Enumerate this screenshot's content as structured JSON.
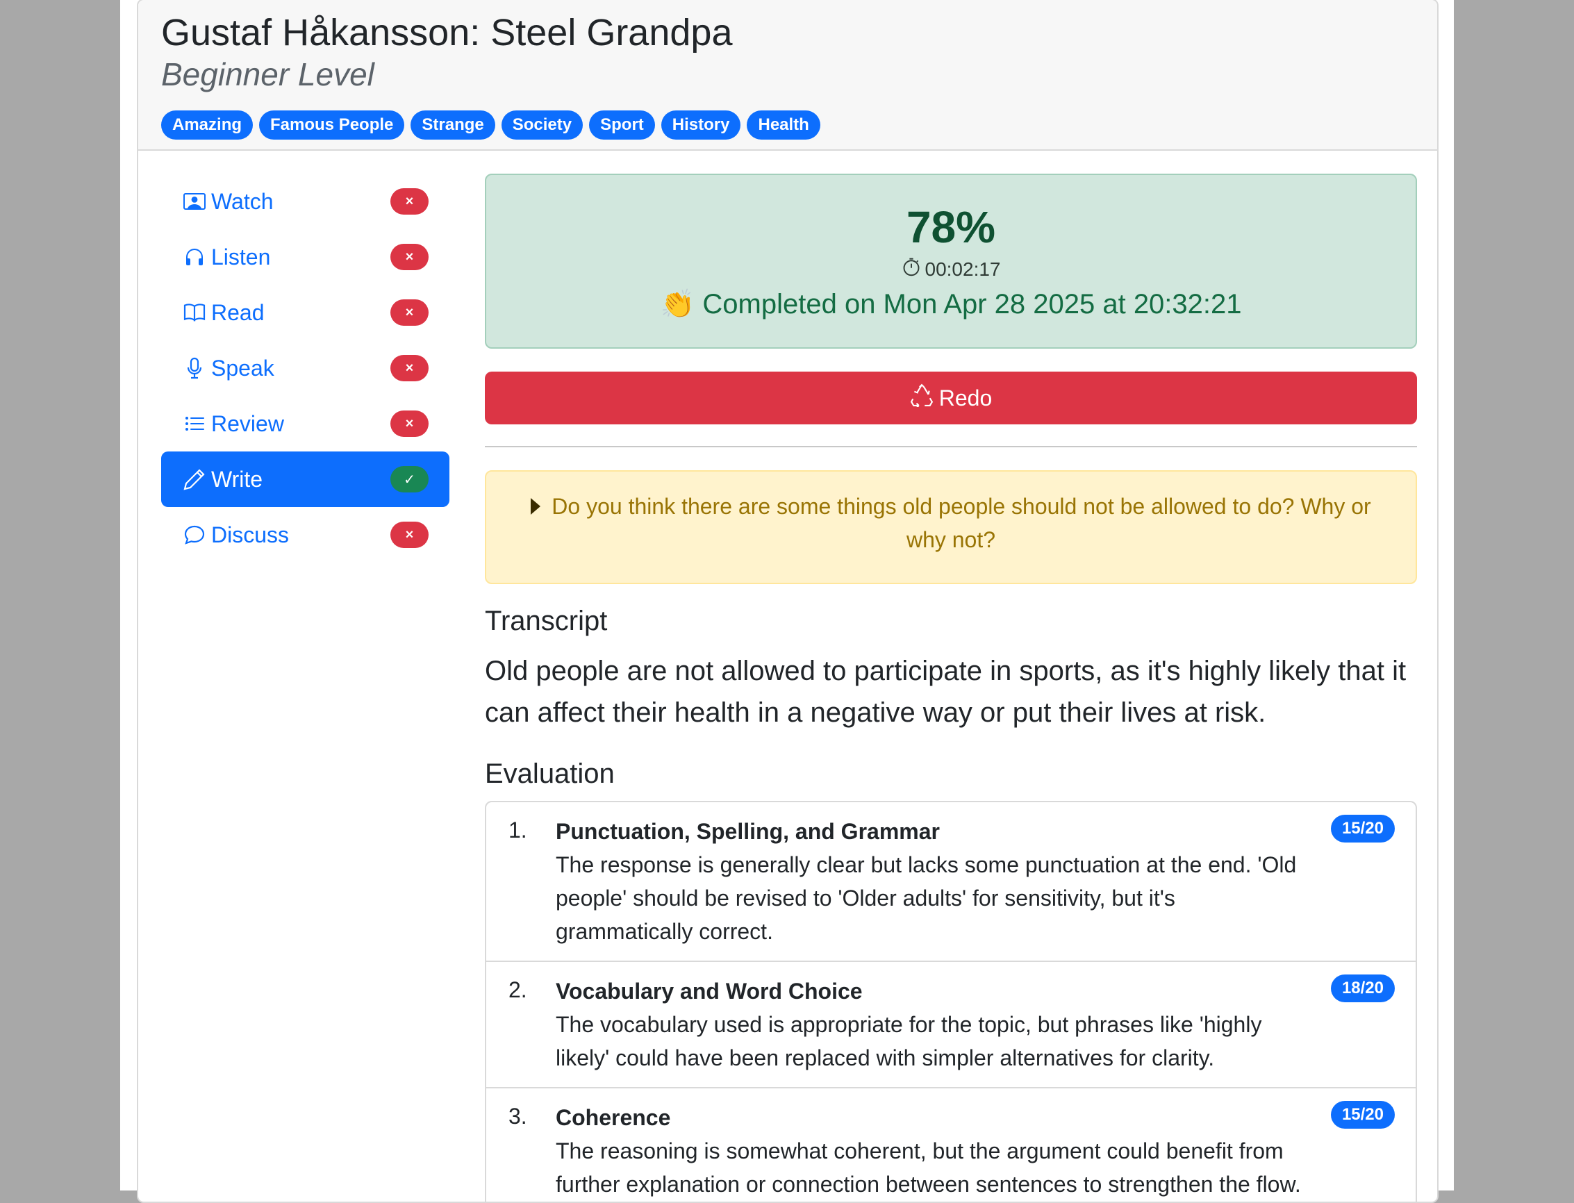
{
  "header": {
    "title": "Gustaf Håkansson: Steel Grandpa",
    "subtitle": "Beginner Level",
    "tags": [
      "Amazing",
      "Famous People",
      "Strange",
      "Society",
      "Sport",
      "History",
      "Health"
    ]
  },
  "sidebar": {
    "items": [
      {
        "label": "Watch",
        "icon": "watch-icon",
        "status": "×",
        "done": false
      },
      {
        "label": "Listen",
        "icon": "headphones-icon",
        "status": "×",
        "done": false
      },
      {
        "label": "Read",
        "icon": "book-icon",
        "status": "×",
        "done": false
      },
      {
        "label": "Speak",
        "icon": "microphone-icon",
        "status": "×",
        "done": false
      },
      {
        "label": "Review",
        "icon": "list-icon",
        "status": "×",
        "done": false
      },
      {
        "label": "Write",
        "icon": "pencil-icon",
        "status": "✓",
        "done": true,
        "active": true
      },
      {
        "label": "Discuss",
        "icon": "chat-bubble-icon",
        "status": "×",
        "done": false
      }
    ]
  },
  "result": {
    "score": "78%",
    "duration": "00:02:17",
    "completed": "👏 Completed on Mon Apr 28 2025 at 20:32:21"
  },
  "redo_label": "Redo",
  "prompt": "Do you think there are some things old people should not be allowed to do? Why or why not?",
  "transcript": {
    "heading": "Transcript",
    "text": "Old people are not allowed to participate in sports, as it's highly likely that it can affect their health in a negative way or put their lives at risk."
  },
  "evaluation": {
    "heading": "Evaluation",
    "items": [
      {
        "num": "1.",
        "title": "Punctuation, Spelling, and Grammar",
        "desc": "The response is generally clear but lacks some punctuation at the end. 'Old people' should be revised to 'Older adults' for sensitivity, but it's grammatically correct.",
        "score": "15/20"
      },
      {
        "num": "2.",
        "title": "Vocabulary and Word Choice",
        "desc": "The vocabulary used is appropriate for the topic, but phrases like 'highly likely' could have been replaced with simpler alternatives for clarity.",
        "score": "18/20"
      },
      {
        "num": "3.",
        "title": "Coherence",
        "desc": "The reasoning is somewhat coherent, but the argument could benefit from further explanation or connection between sentences to strengthen the flow.",
        "score": "15/20"
      }
    ]
  },
  "colors": {
    "primary": "#0d6efd",
    "danger": "#dc3545",
    "success": "#198754",
    "success_bg": "#d1e7dd",
    "warning_bg": "#fff3cd"
  }
}
